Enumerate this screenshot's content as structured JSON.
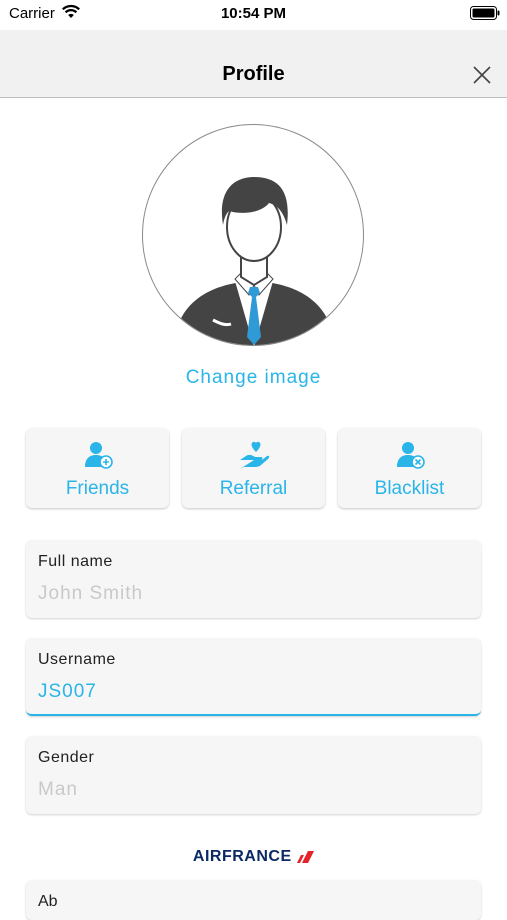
{
  "status_bar": {
    "carrier": "Carrier",
    "time": "10:54 PM"
  },
  "header": {
    "title": "Profile",
    "close_icon": "close-icon"
  },
  "avatar": {
    "icon": "businessman-avatar",
    "change_label": "Change image"
  },
  "quick_actions": [
    {
      "label": "Friends",
      "icon": "add-user-icon"
    },
    {
      "label": "Referral",
      "icon": "heart-hand-icon"
    },
    {
      "label": "Blacklist",
      "icon": "remove-user-icon"
    }
  ],
  "fields": [
    {
      "label": "Full name",
      "value": "John Smith"
    },
    {
      "label": "Username",
      "value": "JS007"
    },
    {
      "label": "Gender",
      "value": "Man"
    }
  ],
  "brand": {
    "logo_text": "AIRFRANCE"
  },
  "partial_field": {
    "label": "Ab"
  },
  "colors": {
    "accent": "#29b5e8",
    "placeholder": "#c9c9c9",
    "brand": "#0b2a63",
    "brand_red": "#e4232a"
  }
}
